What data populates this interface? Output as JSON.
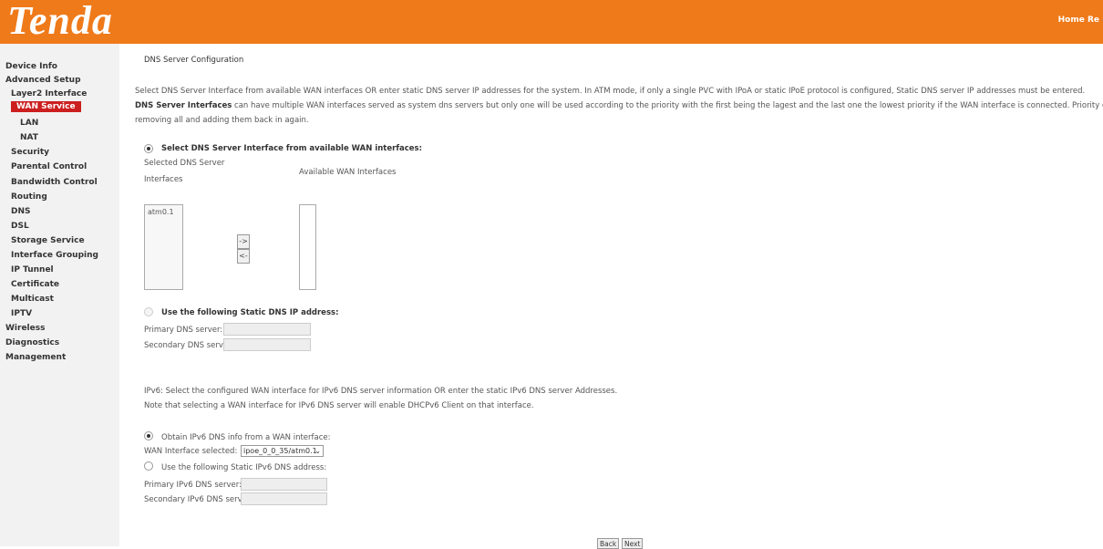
{
  "brand": {
    "logo": "Tenda",
    "home_link": "Home Re"
  },
  "sidebar": [
    {
      "label": "Device Info",
      "level": 1
    },
    {
      "label": "Advanced Setup",
      "level": 1
    },
    {
      "label": "Layer2 Interface",
      "level": 2
    },
    {
      "label": "WAN Service",
      "level": 2,
      "active": true
    },
    {
      "label": "LAN",
      "level": 3
    },
    {
      "label": "NAT",
      "level": 3
    },
    {
      "label": "Security",
      "level": 2
    },
    {
      "label": "Parental Control",
      "level": 2
    },
    {
      "label": "Bandwidth Control",
      "level": 2
    },
    {
      "label": "Routing",
      "level": 2
    },
    {
      "label": "DNS",
      "level": 2
    },
    {
      "label": "DSL",
      "level": 2
    },
    {
      "label": "Storage Service",
      "level": 2
    },
    {
      "label": "Interface Grouping",
      "level": 2
    },
    {
      "label": "IP Tunnel",
      "level": 2
    },
    {
      "label": "Certificate",
      "level": 2
    },
    {
      "label": "Multicast",
      "level": 2
    },
    {
      "label": "IPTV",
      "level": 2
    },
    {
      "label": "Wireless",
      "level": 1
    },
    {
      "label": "Diagnostics",
      "level": 1
    },
    {
      "label": "Management",
      "level": 1
    }
  ],
  "page": {
    "title": "DNS Server Configuration",
    "intro1": "Select DNS Server Interface from available WAN interfaces OR enter static DNS server IP addresses for the system. In ATM mode, if only a single PVC with IPoA or static IPoE protocol is configured, Static DNS server IP addresses must be entered.",
    "intro2_bold": "DNS Server Interfaces",
    "intro2_rest": "can have multiple WAN interfaces served as system dns servers but only one will be used according to the priority with the first being the lagest and the last one the lowest priority if the WAN interface is connected. Priority order can be changed by",
    "intro3": "removing all and adding them back in again.",
    "opt_wan_label": "Select DNS Server Interface from available WAN interfaces:",
    "selected_dns_label_1": "Selected DNS Server",
    "selected_dns_label_2": "Interfaces",
    "available_wan_label": "Available WAN Interfaces",
    "selected_list": [
      "atm0.1"
    ],
    "available_list": [],
    "add_arrow": "->",
    "remove_arrow": "<-",
    "opt_static_label": "Use the following Static DNS IP address:",
    "primary_dns_label": "Primary DNS server:",
    "secondary_dns_label": "Secondary DNS server:",
    "primary_dns_value": "",
    "secondary_dns_value": "",
    "ipv6_text1": "IPv6: Select the configured WAN interface for IPv6 DNS server information OR enter the static IPv6 DNS server Addresses.",
    "ipv6_text2": "Note that selecting a WAN interface for IPv6 DNS server will enable DHCPv6 Client on that interface.",
    "ipv6_opt_wan_label": "Obtain IPv6 DNS info from a WAN interface:",
    "wan_interface_selected_label": "WAN Interface selected:",
    "wan_interface_selected_value": "ipoe_0_0_35/atm0.1",
    "ipv6_opt_static_label": "Use the following Static IPv6 DNS address:",
    "primary_ipv6_label": "Primary IPv6 DNS server:",
    "secondary_ipv6_label": "Secondary IPv6 DNS server:",
    "primary_ipv6_value": "",
    "secondary_ipv6_value": "",
    "back_button": "Back",
    "next_button": "Next"
  }
}
